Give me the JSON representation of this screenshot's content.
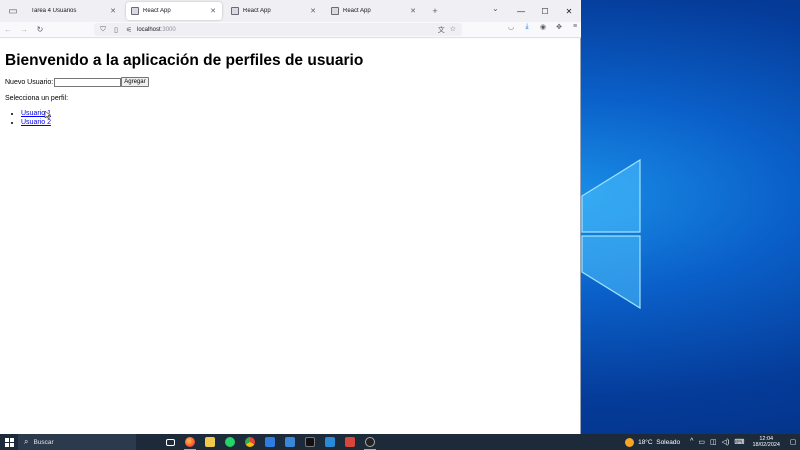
{
  "browser": {
    "tabs": [
      {
        "title": "Tarea 4 Usuarios",
        "active": false
      },
      {
        "title": "React App",
        "active": true
      },
      {
        "title": "React App",
        "active": false
      },
      {
        "title": "React App",
        "active": false
      }
    ],
    "url_host": "localhost",
    "url_port": ":3000",
    "window_controls": {
      "minimize": "—",
      "maximize": "☐",
      "close": "✕"
    }
  },
  "page": {
    "heading": "Bienvenido a la aplicación de perfiles de usuario",
    "new_user_label": "Nuevo Usuario:",
    "new_user_value": "",
    "add_button": "Agregar",
    "select_prompt": "Selecciona un perfil:",
    "users": [
      "Usuario 1",
      "Usuario 2"
    ]
  },
  "taskbar": {
    "search_placeholder": "Buscar",
    "weather_temp": "18°C",
    "weather_text": "Soleado",
    "time": "12:04",
    "date": "18/02/2024"
  },
  "colors": {
    "link": "#0000ee",
    "taskbar_bg": "#1c2a3a",
    "accent": "#0060df"
  }
}
